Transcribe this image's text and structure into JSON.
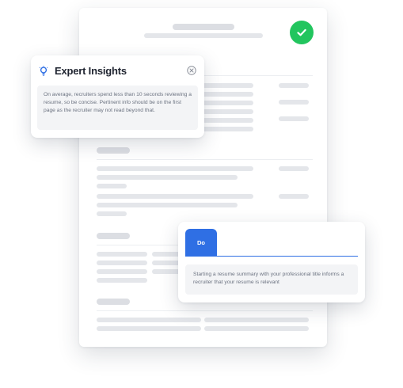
{
  "insights": {
    "title": "Expert Insights",
    "icon": "lightbulb-icon",
    "close_icon": "close-icon",
    "body": "On average, recruiters spend less than 10 seconds reviewing a resume, so be concise. Pertinent info should be on the first page as the recruiter may not read beyond that."
  },
  "do_card": {
    "tab_label": "Do",
    "body": "Starting a resume summary with your professional title informs a recruiter that your resume is relevant"
  },
  "status": {
    "icon": "check-circle-icon",
    "color": "#22c55e"
  },
  "colors": {
    "accent": "#2f6fe4",
    "placeholder": "#e4e6ea"
  }
}
